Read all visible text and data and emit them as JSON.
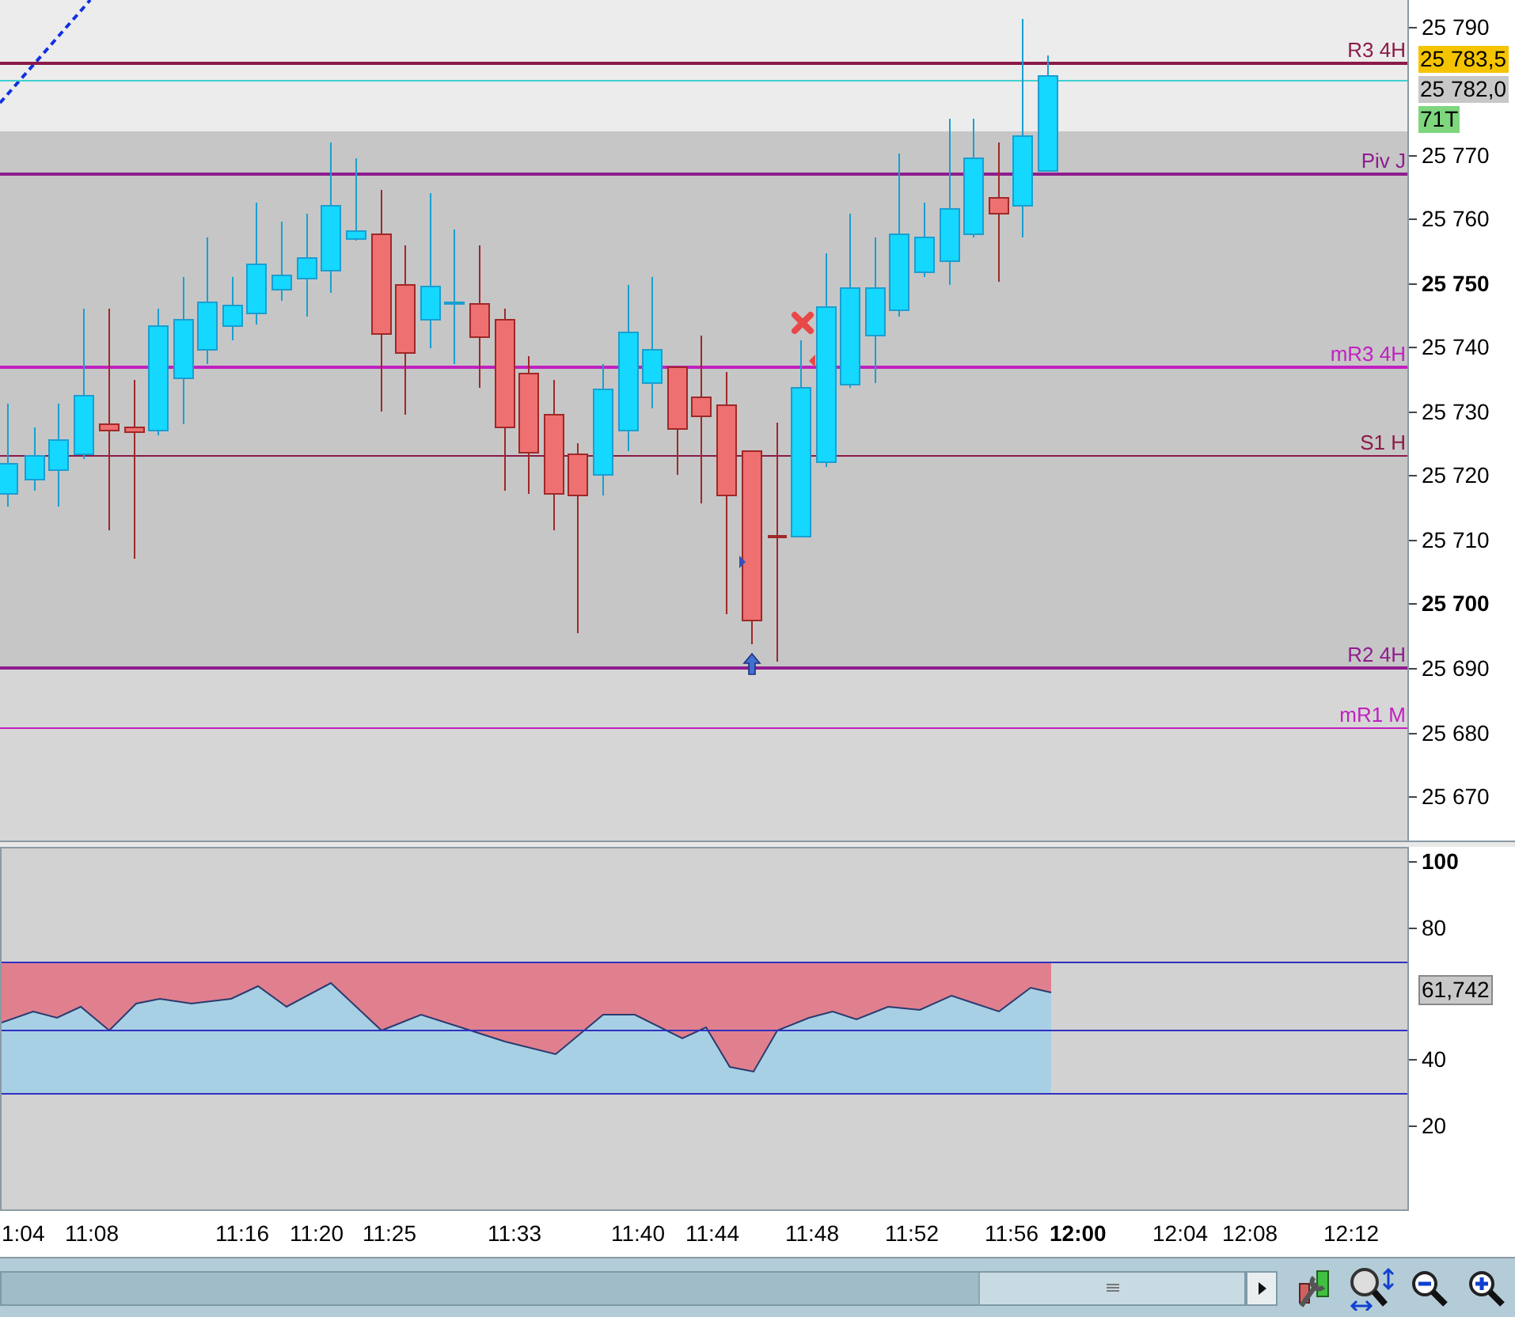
{
  "price_axis": {
    "ticks": [
      {
        "label": "25 790",
        "bold": false
      },
      {
        "label": "25 770",
        "bold": false
      },
      {
        "label": "25 760",
        "bold": false
      },
      {
        "label": "25 750",
        "bold": true
      },
      {
        "label": "25 740",
        "bold": false
      },
      {
        "label": "25 730",
        "bold": false
      },
      {
        "label": "25 720",
        "bold": false
      },
      {
        "label": "25 710",
        "bold": false
      },
      {
        "label": "25 700",
        "bold": true
      },
      {
        "label": "25 690",
        "bold": false
      },
      {
        "label": "25 680",
        "bold": false
      },
      {
        "label": "25 670",
        "bold": false
      }
    ]
  },
  "price_badges": [
    {
      "label": "25 783,5",
      "color": "#f5c400"
    },
    {
      "label": "25 782,0",
      "color": "#c8c8c8"
    },
    {
      "label": "71T",
      "color": "#7ed67e"
    }
  ],
  "levels": [
    {
      "label": "R3 4H",
      "color": "#8b1a4a"
    },
    {
      "label": "Piv J",
      "color": "#8e1c8e"
    },
    {
      "label": "mR3 4H",
      "color": "#c020c0"
    },
    {
      "label": "S1 H",
      "color": "#8b1a4a"
    },
    {
      "label": "R2 4H",
      "color": "#8e1c8e"
    },
    {
      "label": "mR1 M",
      "color": "#c020c0"
    }
  ],
  "oscillator": {
    "ticks": [
      {
        "label": "100",
        "bold": true
      },
      {
        "label": "80",
        "bold": false
      },
      {
        "label": "40",
        "bold": false
      },
      {
        "label": "20",
        "bold": false
      }
    ],
    "value_badge": "61,742"
  },
  "time_axis": {
    "ticks": [
      {
        "label": "1:04",
        "bold": false
      },
      {
        "label": "11:08",
        "bold": false
      },
      {
        "label": "11:16",
        "bold": false
      },
      {
        "label": "11:20",
        "bold": false
      },
      {
        "label": "11:25",
        "bold": false
      },
      {
        "label": "11:33",
        "bold": false
      },
      {
        "label": "11:40",
        "bold": false
      },
      {
        "label": "11:44",
        "bold": false
      },
      {
        "label": "11:48",
        "bold": false
      },
      {
        "label": "11:52",
        "bold": false
      },
      {
        "label": "11:56",
        "bold": false
      },
      {
        "label": "12:00",
        "bold": true
      },
      {
        "label": "12:04",
        "bold": false
      },
      {
        "label": "12:08",
        "bold": false
      },
      {
        "label": "12:12",
        "bold": false
      }
    ]
  }
}
